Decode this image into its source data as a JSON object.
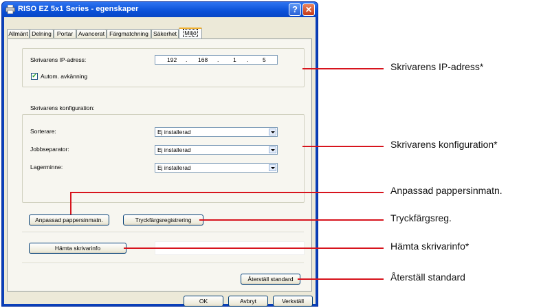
{
  "window": {
    "title": "RISO EZ 5x1 Series - egenskaper",
    "help_label": "?",
    "close_label": "✕"
  },
  "tabs": [
    {
      "label": "Allmänt"
    },
    {
      "label": "Delning"
    },
    {
      "label": "Portar"
    },
    {
      "label": "Avancerat"
    },
    {
      "label": "Färgmatchning"
    },
    {
      "label": "Säkerhet"
    },
    {
      "label": "Miljö",
      "active": true
    }
  ],
  "ip_section": {
    "label": "Skrivarens IP-adress:",
    "octets": [
      "192",
      "168",
      "1",
      "5"
    ],
    "auto_detect_label": "Autom. avkänning",
    "auto_detect_checked": true
  },
  "config_section": {
    "heading": "Skrivarens konfiguration:",
    "rows": [
      {
        "label": "Sorterare:",
        "value": "Ej installerad"
      },
      {
        "label": "Jobbseparator:",
        "value": "Ej installerad"
      },
      {
        "label": "Lagerminne:",
        "value": "Ej installerad"
      }
    ]
  },
  "buttons": {
    "custom_paper": "Anpassad pappersinmatn.",
    "ink_color_reg": "Tryckfärgsregistrering",
    "get_printer_info": "Hämta skrivarinfo",
    "restore_default": "Återställ standard",
    "ok": "OK",
    "cancel": "Avbryt",
    "apply": "Verkställ"
  },
  "callouts": {
    "ip": "Skrivarens IP-adress*",
    "config": "Skrivarens konfiguration*",
    "custom_paper": "Anpassad pappersinmatn.",
    "ink_color_reg": "Tryckfärgsreg.",
    "printer_info": "Hämta skrivarinfo*",
    "restore": "Återställ standard"
  },
  "colors": {
    "callout_line": "#d7141d",
    "titlebar": "#0a50d8"
  }
}
